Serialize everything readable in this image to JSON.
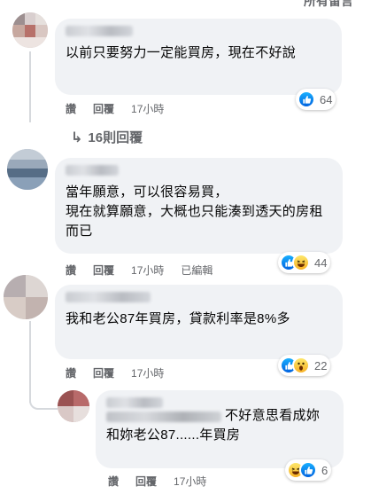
{
  "header": {
    "sort_label": "所有留言"
  },
  "comments": [
    {
      "text": "以前只要努力一定能買房，現在不好說",
      "actions": {
        "like": "讚",
        "reply": "回覆",
        "time": "17小時"
      },
      "reaction_count": "64",
      "reactions": [
        "like"
      ],
      "replies_link": "16則回覆"
    },
    {
      "text": "當年願意，可以很容易買，\n現在就算願意，大概也只能湊到透天的房租而已",
      "actions": {
        "like": "讚",
        "reply": "回覆",
        "time": "17小時",
        "edited": "已編輯"
      },
      "reaction_count": "44",
      "reactions": [
        "like",
        "haha"
      ]
    },
    {
      "text": "我和老公87年買房，貸款利率是8%多",
      "actions": {
        "like": "讚",
        "reply": "回覆",
        "time": "17小時"
      },
      "reaction_count": "22",
      "reactions": [
        "like",
        "wow"
      ]
    },
    {
      "text": "不好意思看成妳和妳老公87......年買房",
      "actions": {
        "like": "讚",
        "reply": "回覆",
        "time": "17小時"
      },
      "reaction_count": "6",
      "reactions": [
        "haha",
        "like"
      ]
    }
  ],
  "colors": {
    "bubble": "#f0f2f5",
    "like_blue": "#1877f2",
    "meta_gray": "#65676b"
  },
  "icons": {
    "like": "thumbs-up-icon",
    "haha": "laughing-face-icon",
    "wow": "surprised-face-icon",
    "reply_arrow": "reply-arrow-icon"
  }
}
